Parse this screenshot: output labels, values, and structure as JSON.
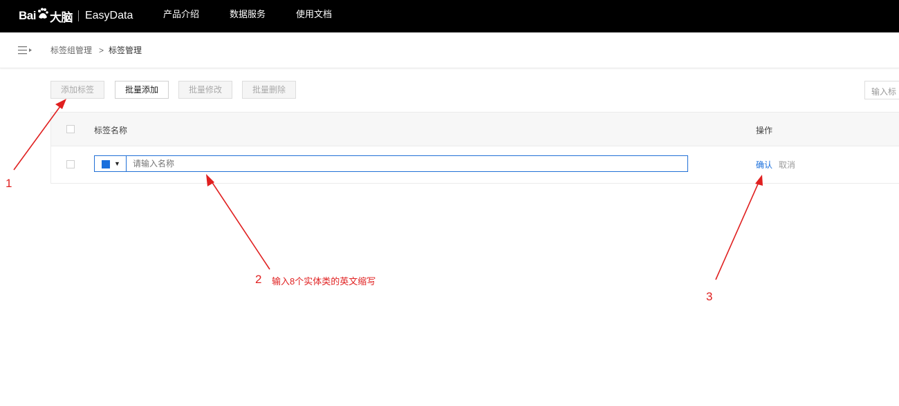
{
  "header": {
    "logo_baidu_left": "Bai",
    "logo_baidu_right": "大脑",
    "logo_product": "EasyData",
    "nav": [
      {
        "label": "产品介绍"
      },
      {
        "label": "数据服务"
      },
      {
        "label": "使用文档"
      }
    ]
  },
  "breadcrumb": {
    "menu_icon": "menu-collapse-icon",
    "items": [
      "标签组管理",
      "标签管理"
    ],
    "separator": ">"
  },
  "toolbar": {
    "add_label": "添加标签",
    "batch_add": "批量添加",
    "batch_edit": "批量修改",
    "batch_delete": "批量删除",
    "search_placeholder": "输入标"
  },
  "table": {
    "columns": {
      "name": "标签名称",
      "ops": "操作"
    },
    "edit_row": {
      "color": "#1a6fdc",
      "name_placeholder": "请输入名称",
      "confirm": "确认",
      "cancel": "取消"
    }
  },
  "annotations": {
    "n1": "1",
    "n2": "2",
    "n3": "3",
    "note2": "输入8个实体类的英文缩写",
    "color": "#e02020"
  }
}
